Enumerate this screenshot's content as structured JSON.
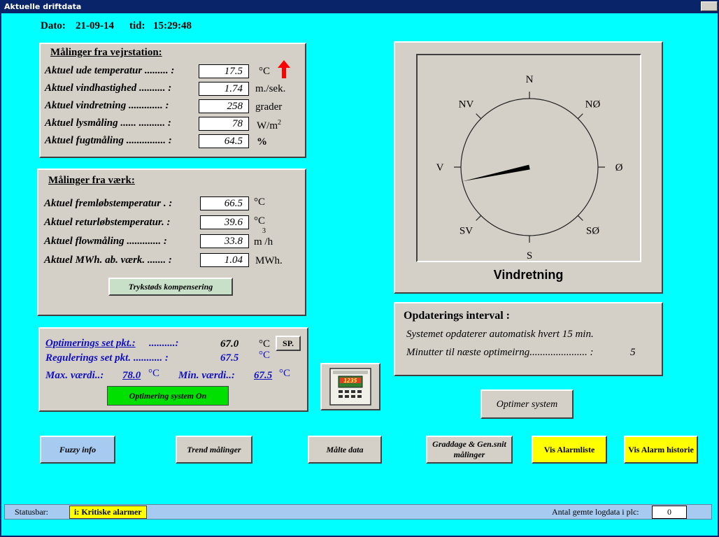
{
  "window": {
    "title": "Aktuelle driftdata"
  },
  "header": {
    "date_label": "Dato:",
    "date_value": "21-09-14",
    "time_label": "tid:",
    "time_value": "15:29:48"
  },
  "weather": {
    "title": "Målinger fra vejrstation:",
    "rows": [
      {
        "label": "Aktuel ude temperatur ......... :",
        "value": "17.5",
        "unit": "°C"
      },
      {
        "label": "Aktuel vindhastighed .......... :",
        "value": "1.74",
        "unit": "m./sek."
      },
      {
        "label": "Aktuel vindretning ............. :",
        "value": "258",
        "unit": "grader"
      },
      {
        "label": "Aktuel lysmåling ...... .......... :",
        "value": "78",
        "unit": "W/m",
        "unit_sup": "2"
      },
      {
        "label": "Aktuel fugtmåling ............... :",
        "value": "64.5",
        "unit": "%"
      }
    ],
    "trend_color": "#ff0000"
  },
  "plant": {
    "title": "Målinger fra værk:",
    "rows": [
      {
        "label": "Aktuel fremløbstemperatur . :",
        "value": "66.5",
        "unit": "°C"
      },
      {
        "label": "Aktuel returløbstemperatur. :",
        "value": "39.6",
        "unit": "°C"
      },
      {
        "label": "Aktuel flowmåling ............. :",
        "value": "33.8",
        "unit_sup": "3",
        "unit": "m /h"
      },
      {
        "label": "Aktuel MWh. ab. værk. ....... :",
        "value": "1.04",
        "unit": "MWh."
      }
    ],
    "button": "Trykstøds kompensering"
  },
  "optim": {
    "opt_label": "Optimerings set pkt.:",
    "opt_dots": "..........:",
    "opt_value": "67.0",
    "opt_unit": "°C",
    "sp_button": "SP.",
    "reg_label": "Regulerings set pkt. ........... :",
    "reg_value": "67.5",
    "reg_unit": "°C",
    "max_label": "Max. værdi..:",
    "max_value": "78.0",
    "max_unit": "°C",
    "min_label": "Min. værdi..:",
    "min_value": "67.5",
    "min_unit": "°C",
    "status_button": "Optimering system On",
    "status_color": "#00e000"
  },
  "compass": {
    "labels": {
      "n": "N",
      "ne": "NØ",
      "e": "Ø",
      "se": "SØ",
      "s": "S",
      "sw": "SV",
      "w": "V",
      "nw": "NV"
    },
    "direction_deg": 258,
    "caption": "Vindretning"
  },
  "update": {
    "title": "Opdaterings interval :",
    "line1": "Systemet opdaterer automatisk hvert 15 min.",
    "line2_label": "Minutter til næste optimeirng...................... :",
    "line2_value": "5"
  },
  "controller_display": "1235",
  "buttons": {
    "optimize": "Optimer system",
    "fuzzy": "Fuzzy info",
    "trend": "Trend målinger",
    "measured": "Målte data",
    "degree_days": "Graddage & Gen.snit målinger",
    "alarm_list": "Vis Alarmliste",
    "alarm_history": "Vis Alarm historie"
  },
  "statusbar": {
    "label": "Statusbar:",
    "critical": "i: Kritiske alarmer",
    "log_label": "Antal gemte logdata i plc:",
    "log_value": "0"
  },
  "colors": {
    "background": "#00ffff",
    "panel": "#d4d0c8",
    "yellow": "#ffff00",
    "light_blue": "#a6caf0",
    "value_blue": "#1010c0"
  }
}
